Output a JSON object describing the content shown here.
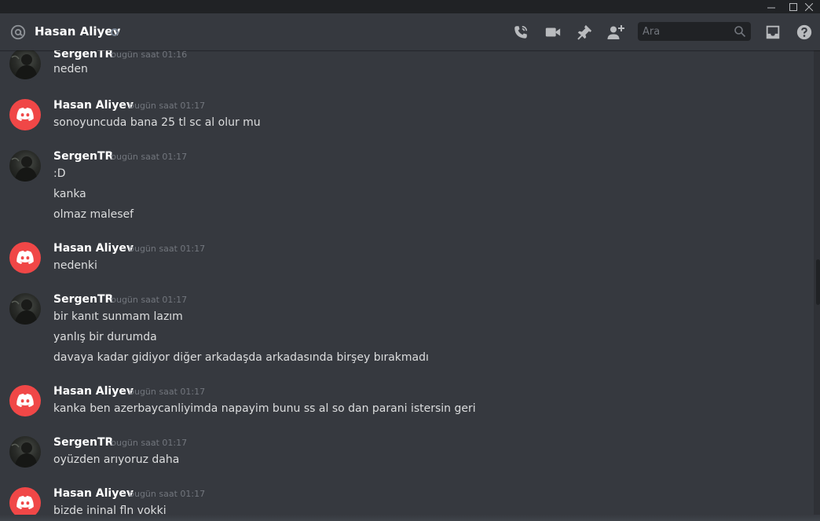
{
  "window": {
    "min_glyph": "—",
    "max_glyph": "☐",
    "close_glyph": "✕"
  },
  "header": {
    "title": "Hasan Aliyev",
    "status": "offline",
    "icons": [
      "voice-call-icon",
      "video-call-icon",
      "pinned-messages-icon",
      "add-friend-icon",
      "inbox-icon",
      "help-icon"
    ]
  },
  "search": {
    "placeholder": "Ara",
    "value": ""
  },
  "messages": [
    {
      "author": "SergenTR",
      "avatar": "photo",
      "time": "bugün saat 01:16",
      "lines": [
        "neden"
      ]
    },
    {
      "author": "Hasan Aliyev",
      "avatar": "discord",
      "time": "bugün saat 01:17",
      "lines": [
        "sonoyuncuda bana 25 tl sc al olur mu"
      ]
    },
    {
      "author": "SergenTR",
      "avatar": "photo",
      "time": "bugün saat 01:17",
      "lines": [
        ":D",
        "kanka",
        "olmaz malesef"
      ]
    },
    {
      "author": "Hasan Aliyev",
      "avatar": "discord",
      "time": "bugün saat 01:17",
      "lines": [
        "nedenki"
      ]
    },
    {
      "author": "SergenTR",
      "avatar": "photo",
      "time": "bugün saat 01:17",
      "lines": [
        "bir kanıt sunmam lazım",
        "yanlış bir durumda",
        "davaya kadar gidiyor diğer arkadaşda arkadasında birşey bırakmadı"
      ]
    },
    {
      "author": "Hasan Aliyev",
      "avatar": "discord",
      "time": "bugün saat 01:17",
      "lines": [
        "kanka ben azerbaycanliyimda napayim bunu ss al so dan parani istersin geri"
      ]
    },
    {
      "author": "SergenTR",
      "avatar": "photo",
      "time": "bugün saat 01:17",
      "lines": [
        "oyüzden arıyoruz daha"
      ]
    },
    {
      "author": "Hasan Aliyev",
      "avatar": "discord",
      "time": "bugün saat 01:17",
      "lines": [
        "bizde ininal fln vokki"
      ]
    }
  ],
  "colors": {
    "background": "#36393f",
    "discord_red": "#f04747",
    "username": "#ffffff",
    "timestamp": "#72767d",
    "text": "#dcddde"
  }
}
